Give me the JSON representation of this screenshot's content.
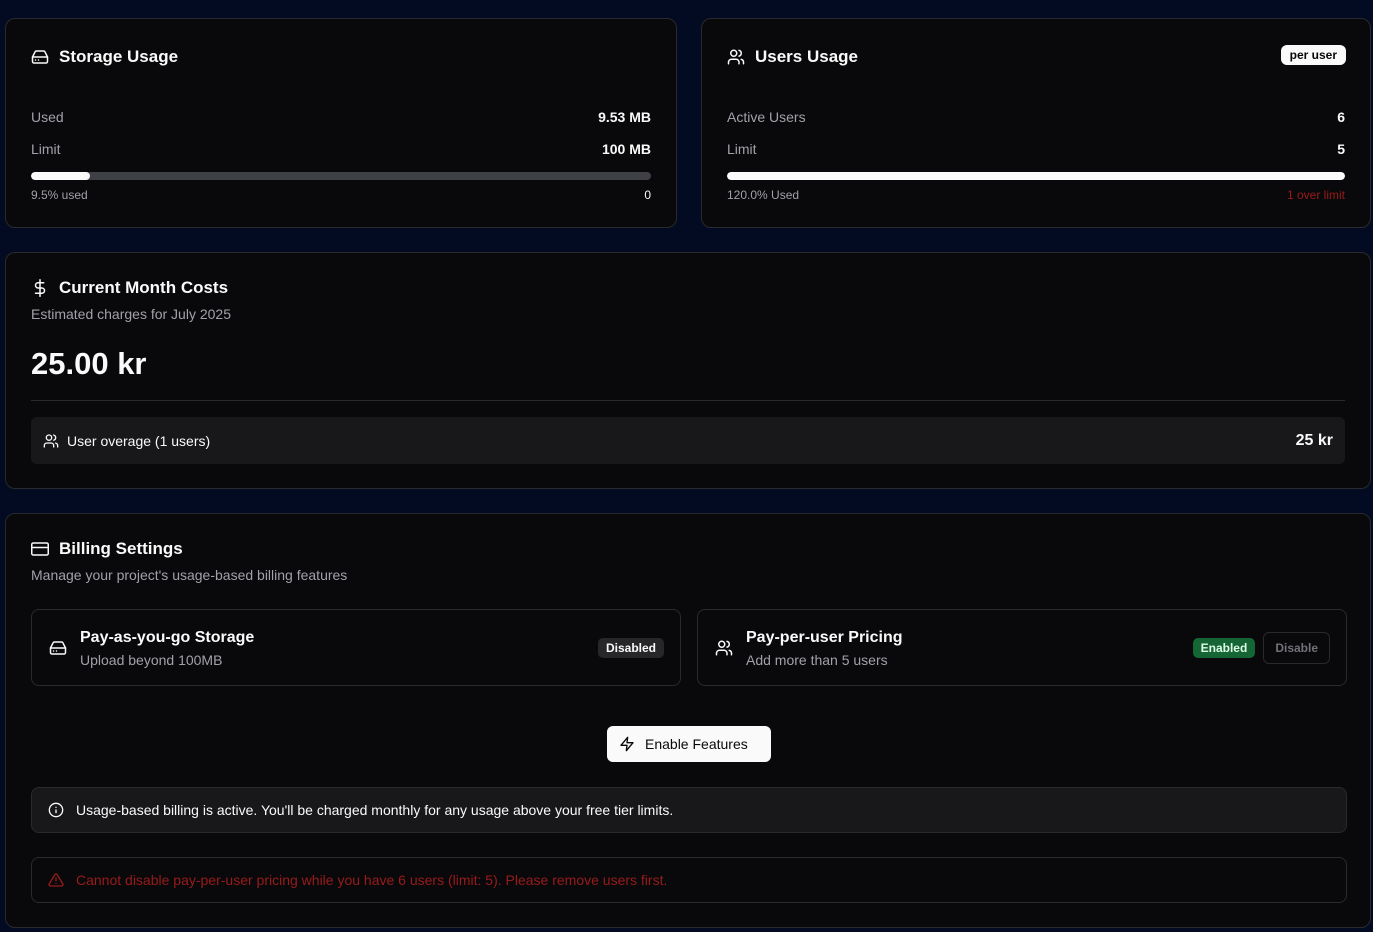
{
  "storage": {
    "title": "Storage Usage",
    "used_label": "Used",
    "used_value": "9.53 MB",
    "limit_label": "Limit",
    "limit_value": "100 MB",
    "progress_fraction": 0.095,
    "percent_text": "9.5% used",
    "right_text": "0"
  },
  "users": {
    "title": "Users Usage",
    "badge": "per user",
    "active_label": "Active Users",
    "active_value": "6",
    "limit_label": "Limit",
    "limit_value": "5",
    "progress_fraction": 1.0,
    "percent_text": "120.0% Used",
    "over_text": "1 over limit"
  },
  "costs": {
    "title": "Current Month Costs",
    "subtitle": "Estimated charges for July 2025",
    "total": "25.00 kr",
    "line_item_label": "User overage (1 users)",
    "line_item_value": "25 kr"
  },
  "billing": {
    "title": "Billing Settings",
    "subtitle": "Manage your project's usage-based billing features",
    "storage_feature": {
      "title": "Pay-as-you-go Storage",
      "desc": "Upload beyond 100MB",
      "status": "Disabled"
    },
    "user_feature": {
      "title": "Pay-per-user Pricing",
      "desc": "Add more than 5 users",
      "status": "Enabled",
      "action": "Disable"
    },
    "enable_button": "Enable Features",
    "info_text": "Usage-based billing is active. You'll be charged monthly for any usage above your free tier limits.",
    "error_text": "Cannot disable pay-per-user pricing while you have 6 users (limit: 5). Please remove users first."
  },
  "colors": {
    "background": "#020b22",
    "card": "#09090b",
    "error": "#991b1b",
    "success": "#166534"
  }
}
